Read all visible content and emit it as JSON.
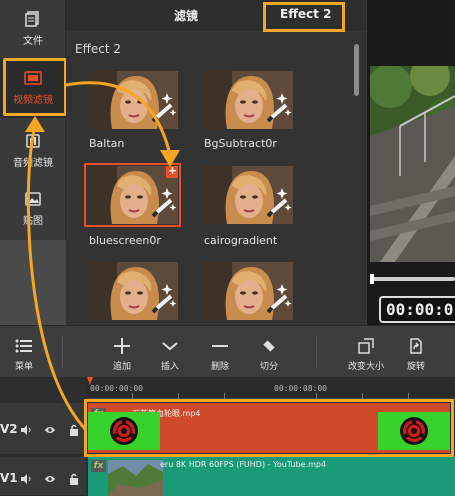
{
  "sidebar": {
    "items": [
      {
        "label": "文件",
        "icon": "file-icon"
      },
      {
        "label": "视频滤镜",
        "icon": "video-filter-icon"
      },
      {
        "label": "音频滤镜",
        "icon": "audio-filter-icon"
      },
      {
        "label": "贴图",
        "icon": "sticker-icon"
      }
    ]
  },
  "tabs": {
    "filters_label": "滤镜",
    "effect2_label": "Effect 2"
  },
  "effects": {
    "section_title": "Effect 2",
    "items": [
      {
        "label": "Baltan"
      },
      {
        "label": "BgSubtract0r"
      },
      {
        "label": "bluescreen0r",
        "badge": "+"
      },
      {
        "label": "cairogradient"
      },
      {
        "label": ""
      },
      {
        "label": ""
      }
    ]
  },
  "preview": {
    "timecode": "00:00:0"
  },
  "toolbar": {
    "menu_label": "菜单",
    "add_label": "追加",
    "insert_label": "插入",
    "delete_label": "删除",
    "cut_label": "切分",
    "resize_label": "改变大小",
    "rotate_label": "旋转"
  },
  "timeline": {
    "ruler": [
      "00:00:00:00",
      "00:00:08:00"
    ],
    "tracks": [
      {
        "name": "V2",
        "clip": "万花筒血轮眼.mp4",
        "fx": "fx"
      },
      {
        "name": "V1",
        "clip": "eru 8K HDR 60FPS (FUHD) - YouTube.mp4",
        "fx": "fx"
      }
    ]
  },
  "colors": {
    "accent": "#e8502a",
    "highlight": "#f5a623",
    "clip_v2": "#cf4a2a",
    "green_screen": "#37d22c",
    "clip_v1": "#1a9b78"
  }
}
